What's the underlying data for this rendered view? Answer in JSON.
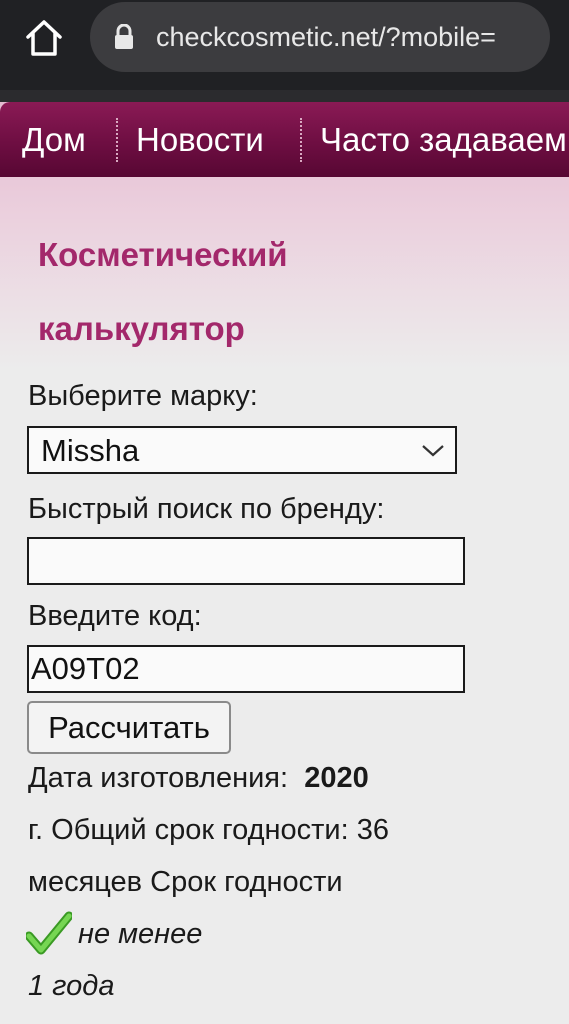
{
  "browser": {
    "url": "checkcosmetic.net/?mobile=",
    "home_icon": "home-icon",
    "lock_icon": "lock-icon"
  },
  "nav": {
    "items": [
      {
        "label": "Дом"
      },
      {
        "label": "Новости"
      },
      {
        "label": "Часто задаваем"
      }
    ]
  },
  "calculator": {
    "title_line1": "Косметический",
    "title_line2": "калькулятор",
    "brand_label": "Выберите марку:",
    "brand_selected": "Missha",
    "search_label": "Быстрый поиск по бренду:",
    "search_value": "",
    "code_label": "Введите код:",
    "code_value": "A09T02",
    "calculate_label": "Рассчитать"
  },
  "result": {
    "manufacture_label": "Дата изготовления:",
    "manufacture_year": "2020",
    "line2": "г. Общий срок годности: 36",
    "line3": "месяцев Срок годности",
    "check_icon": "check-icon",
    "line4": "не менее",
    "line5": "1 года"
  },
  "colors": {
    "nav_bg": "#6e0e42",
    "title": "#a3286b",
    "check": "#5cc63a"
  }
}
